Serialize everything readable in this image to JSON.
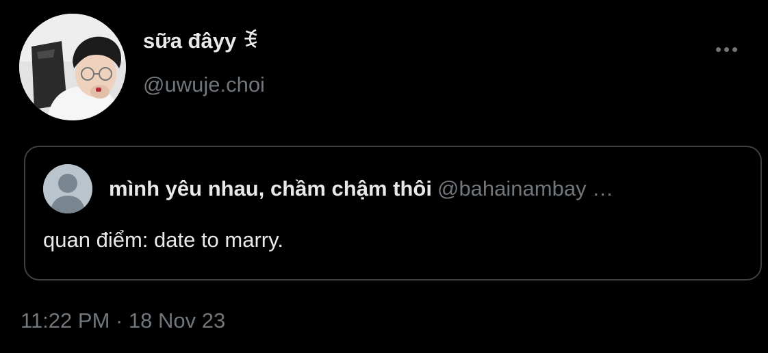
{
  "tweet": {
    "author": {
      "display_name": "sữa đâyy ꉂ",
      "handle": "@uwuje.choi"
    },
    "more_icon": "more-horizontal-icon",
    "quoted": {
      "author_name": "mình yêu nhau, chầm chậm thôi",
      "author_handle": "@bahainambay …",
      "text": "quan điểm: date to marry."
    },
    "timestamp": "11:22 PM · 18 Nov 23"
  },
  "colors": {
    "background": "#000000",
    "primary_text": "#e7e9ea",
    "secondary_text": "#71767b",
    "card_border": "#3e4144",
    "default_avatar_bg": "#b9c4cc"
  }
}
